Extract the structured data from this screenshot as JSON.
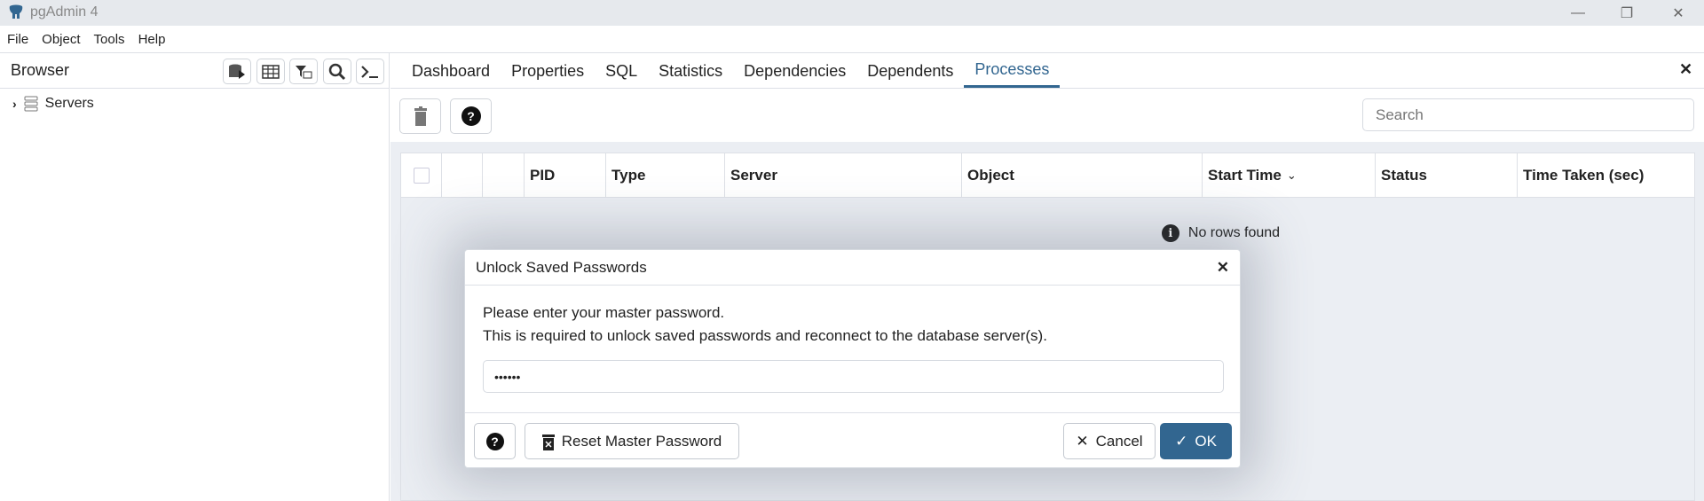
{
  "window": {
    "title": "pgAdmin 4",
    "minimize": "—",
    "restore": "❐",
    "close": "✕"
  },
  "menu": [
    "File",
    "Object",
    "Tools",
    "Help"
  ],
  "browser": {
    "title": "Browser",
    "tree": [
      {
        "label": "Servers",
        "expanded": false
      }
    ]
  },
  "tabs": [
    {
      "label": "Dashboard"
    },
    {
      "label": "Properties"
    },
    {
      "label": "SQL"
    },
    {
      "label": "Statistics"
    },
    {
      "label": "Dependencies"
    },
    {
      "label": "Dependents"
    },
    {
      "label": "Processes",
      "active": true
    }
  ],
  "panel_close": "✕",
  "search": {
    "placeholder": "Search",
    "value": ""
  },
  "grid": {
    "columns": [
      "",
      "",
      "",
      "PID",
      "Type",
      "Server",
      "Object",
      "Start Time",
      "Status",
      "Time Taken (sec)"
    ],
    "sort_column": "Start Time",
    "empty_message": "No rows found",
    "rows": []
  },
  "dialog": {
    "title": "Unlock Saved Passwords",
    "close": "✕",
    "line1": "Please enter your master password.",
    "line2": "This is required to unlock saved passwords and reconnect to the database server(s).",
    "password_value": "••••••",
    "reset_label": "Reset Master Password",
    "cancel_label": "Cancel",
    "ok_label": "OK"
  },
  "colors": {
    "accent": "#326690",
    "panel_bg": "#ebeef3"
  }
}
